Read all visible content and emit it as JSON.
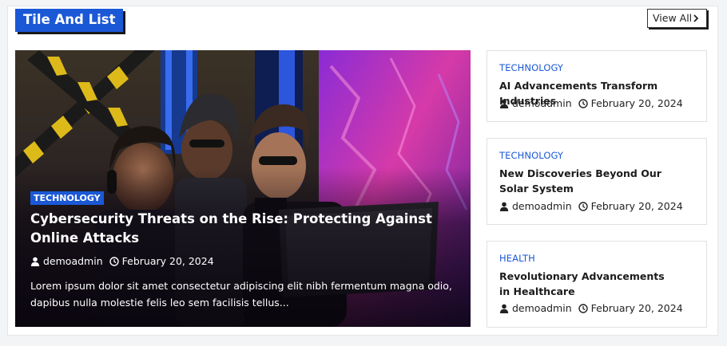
{
  "section": {
    "title": "Tile And List",
    "view_all_label": "View All"
  },
  "featured": {
    "category": "TECHNOLOGY",
    "title": "Cybersecurity Threats on the Rise: Protecting Against Online Attacks",
    "author": "demoadmin",
    "date": "February 20, 2024",
    "excerpt": "Lorem ipsum dolor sit amet consectetur adipiscing elit nibh fermentum magna odio, dapibus nulla molestie felis leo sem facilisis tellus..."
  },
  "list": [
    {
      "category": "TECHNOLOGY",
      "title": "AI Advancements Transform Industries",
      "author": "demoadmin",
      "date": "February 20, 2024"
    },
    {
      "category": "TECHNOLOGY",
      "title": "New Discoveries Beyond Our Solar System",
      "author": "demoadmin",
      "date": "February 20, 2024"
    },
    {
      "category": "HEALTH",
      "title": "Revolutionary Advancements in Healthcare",
      "author": "demoadmin",
      "date": "February 20, 2024"
    }
  ],
  "colors": {
    "accent": "#1b58d6",
    "text": "#1c1c1c",
    "page_bg": "#f3f4f5"
  },
  "icons": {
    "author": "user-icon",
    "date": "clock-icon",
    "view_all": "chevron-right-icon"
  }
}
